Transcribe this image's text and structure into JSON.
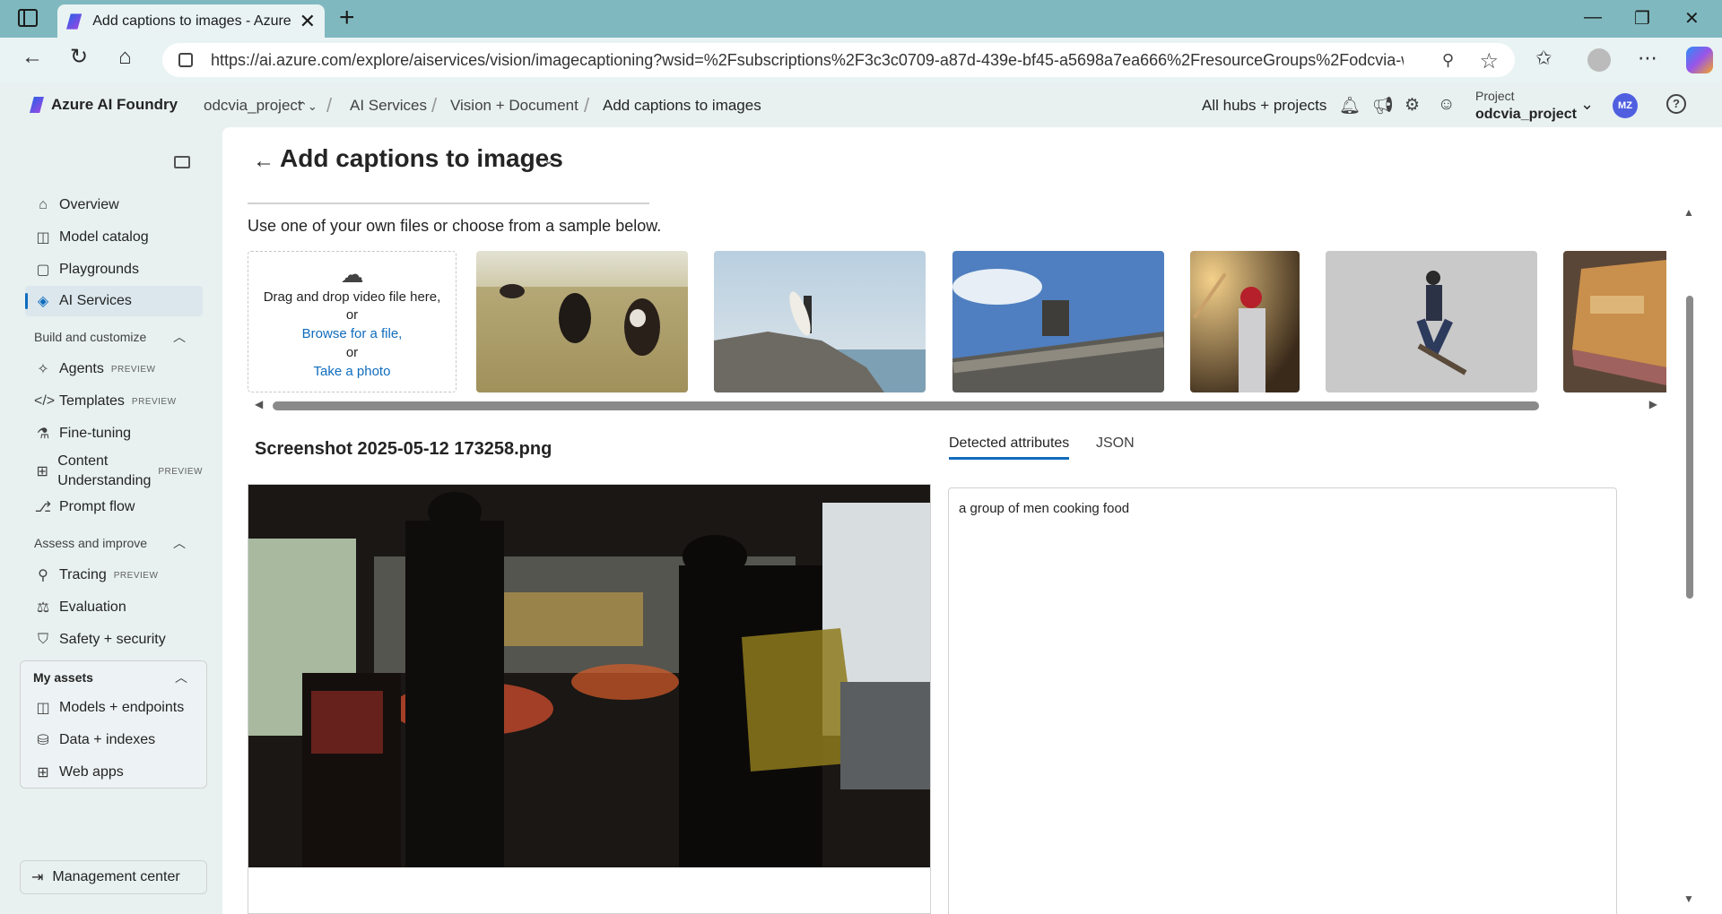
{
  "browser": {
    "tab_title": "Add captions to images - Azure AI Foundry",
    "url": "https://ai.azure.com/explore/aiservices/vision/imagecaptioning?wsid=%2Fsubscriptions%2F3c3c0709-a87d-439e-bf45-a5698a7ea666%2FresourceGroups%2Fodcvia-weste..."
  },
  "header": {
    "brand": "Azure AI Foundry",
    "breadcrumbs": [
      "odcvia_project",
      "AI Services",
      "Vision + Document",
      "Add captions to images"
    ],
    "all_hubs": "All hubs + projects",
    "project_label": "Project",
    "project_name": "odcvia_project",
    "user_initials": "MZ"
  },
  "sidebar": {
    "items_top": [
      {
        "label": "Overview",
        "icon": "home-icon"
      },
      {
        "label": "Model catalog",
        "icon": "cube-icon"
      },
      {
        "label": "Playgrounds",
        "icon": "chat-icon"
      },
      {
        "label": "AI Services",
        "icon": "ai-services-icon",
        "active": true
      }
    ],
    "build_section": "Build and customize",
    "build_items": [
      {
        "label": "Agents",
        "badge": "PREVIEW"
      },
      {
        "label": "Templates",
        "badge": "PREVIEW"
      },
      {
        "label": "Fine-tuning"
      },
      {
        "label": "Content Understanding",
        "badge": "PREVIEW"
      },
      {
        "label": "Prompt flow"
      }
    ],
    "assess_section": "Assess and improve",
    "assess_items": [
      {
        "label": "Tracing",
        "badge": "PREVIEW"
      },
      {
        "label": "Evaluation"
      },
      {
        "label": "Safety + security"
      }
    ],
    "assets_section": "My assets",
    "assets_items": [
      {
        "label": "Models + endpoints"
      },
      {
        "label": "Data + indexes"
      },
      {
        "label": "Web apps"
      }
    ],
    "management": "Management center"
  },
  "main": {
    "title": "Add captions to images",
    "instructions": "Use one of your own files or choose from a sample below.",
    "drop_line1": "Drag and drop video file here,",
    "drop_or1": "or",
    "browse": "Browse for a file,",
    "drop_or2": "or",
    "take_photo": "Take a photo",
    "filename": "Screenshot 2025-05-12 173258.png",
    "tabs": [
      "Detected attributes",
      "JSON"
    ],
    "caption": "a group of men cooking food"
  },
  "colors": {
    "accent": "#0f6cbd",
    "tabstrip": "#7fb9bf",
    "page_bg": "#e8f1f0"
  }
}
